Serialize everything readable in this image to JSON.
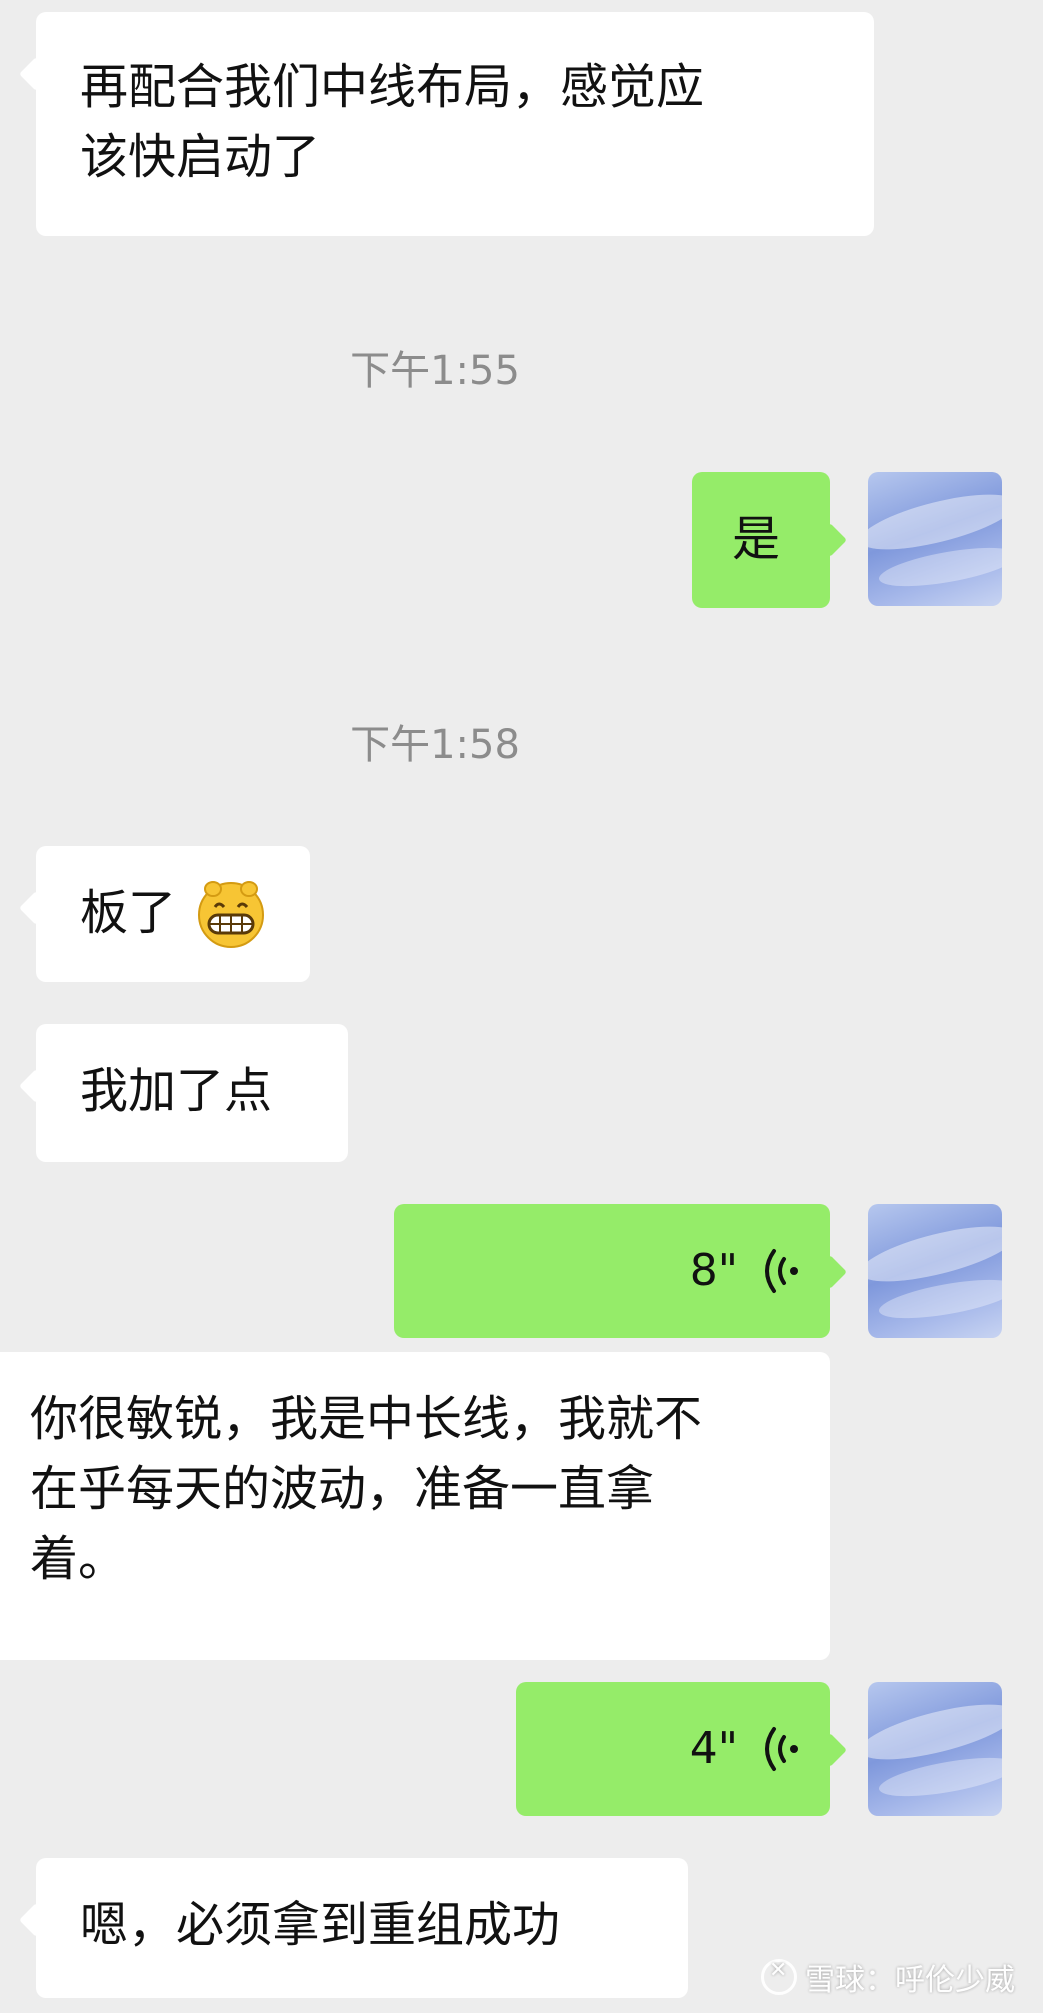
{
  "messages": [
    {
      "side": "left",
      "text": "再配合我们中线布局，感觉应\n该快启动了"
    },
    {
      "type": "time",
      "text": "下午1:55"
    },
    {
      "side": "right",
      "text": "是"
    },
    {
      "type": "time",
      "text": "下午1:58"
    },
    {
      "side": "left",
      "text": "板了"
    },
    {
      "side": "left",
      "text": "我加了点"
    },
    {
      "side": "right",
      "voice_duration": "8\""
    },
    {
      "side": "left",
      "text": "你很敏锐，我是中长线，我就不\n在乎每天的波动，准备一直拿\n着。"
    },
    {
      "side": "right",
      "voice_duration": "4\""
    },
    {
      "side": "left",
      "text": "嗯，必须拿到重组成功"
    }
  ],
  "watermark": {
    "text": "雪球：呼伦少威"
  },
  "colors": {
    "background": "#ededed",
    "incoming_bubble": "#ffffff",
    "outgoing_bubble": "#95ec69",
    "timestamp": "#8c8c8c"
  },
  "icons": {
    "emoji": "grinning-face-emoji",
    "voice": "voice-wave-icon",
    "avatar": "sky-avatar"
  }
}
